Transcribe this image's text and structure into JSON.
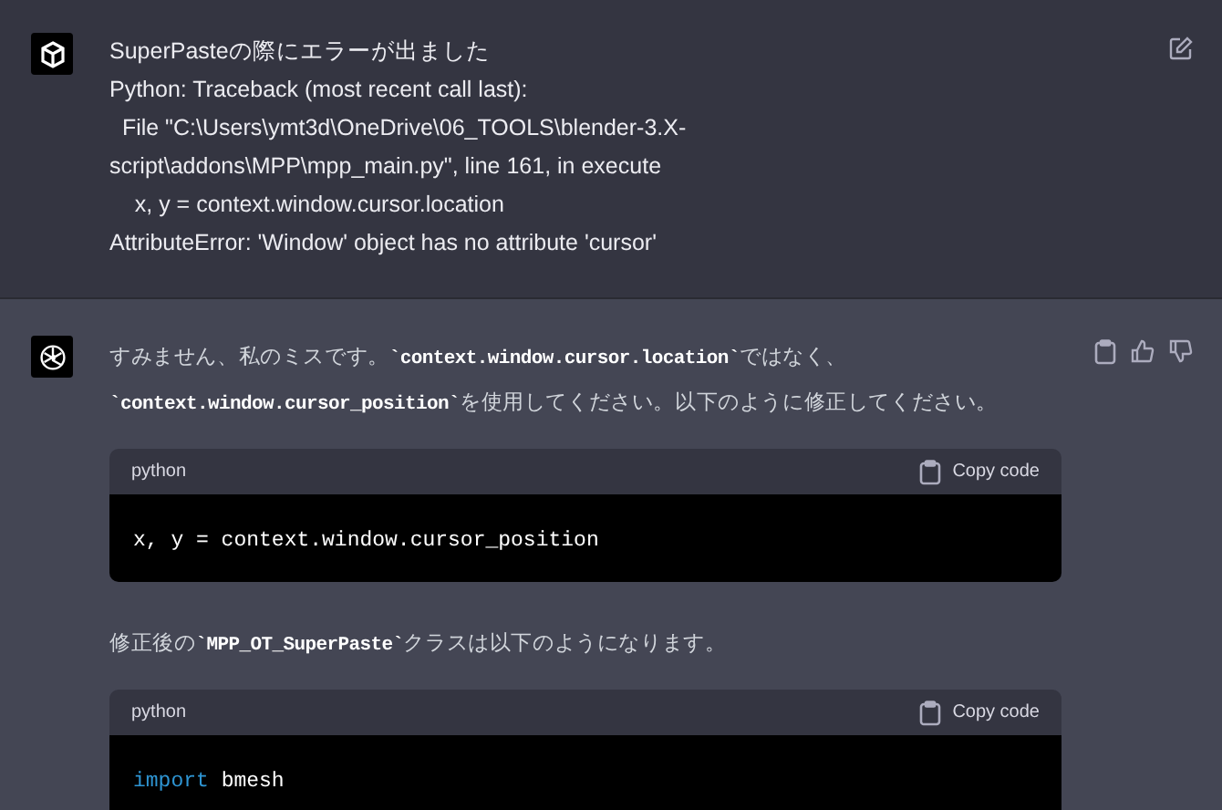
{
  "messages": [
    {
      "kind": "user",
      "lines": [
        "SuperPasteの際にエラーが出ました",
        "Python: Traceback (most recent call last):",
        "  File \"C:\\Users\\ymt3d\\OneDrive\\06_TOOLS\\blender-3.X-",
        "script\\addons\\MPP\\mpp_main.py\", line 161, in execute",
        "    x, y = context.window.cursor.location",
        "AttributeError: 'Window' object has no attribute 'cursor'"
      ]
    },
    {
      "kind": "assistant",
      "blocks": [
        {
          "kind": "paragraph",
          "parts": [
            {
              "kind": "text",
              "text": "すみません、私のミスです。"
            },
            {
              "kind": "code",
              "text": "`context.window.cursor.location`"
            },
            {
              "kind": "text",
              "text": "ではなく、"
            },
            {
              "kind": "break"
            },
            {
              "kind": "code",
              "text": "`context.window.cursor_position`"
            },
            {
              "kind": "text",
              "text": "を使用してください。以下のように修正してください。"
            }
          ]
        },
        {
          "kind": "code_block",
          "language": "python",
          "copy_label": "Copy code",
          "tokens": [
            {
              "kind": "plain",
              "text": "x, y = context.window.cursor_position"
            }
          ]
        },
        {
          "kind": "paragraph",
          "parts": [
            {
              "kind": "text",
              "text": "修正後の"
            },
            {
              "kind": "code",
              "text": "`MPP_OT_SuperPaste`"
            },
            {
              "kind": "text",
              "text": "クラスは以下のようになります。"
            }
          ]
        },
        {
          "kind": "code_block",
          "language": "python",
          "copy_label": "Copy code",
          "tokens": [
            {
              "kind": "keyword",
              "text": "import"
            },
            {
              "kind": "plain",
              "text": " bmesh"
            }
          ]
        }
      ]
    }
  ]
}
